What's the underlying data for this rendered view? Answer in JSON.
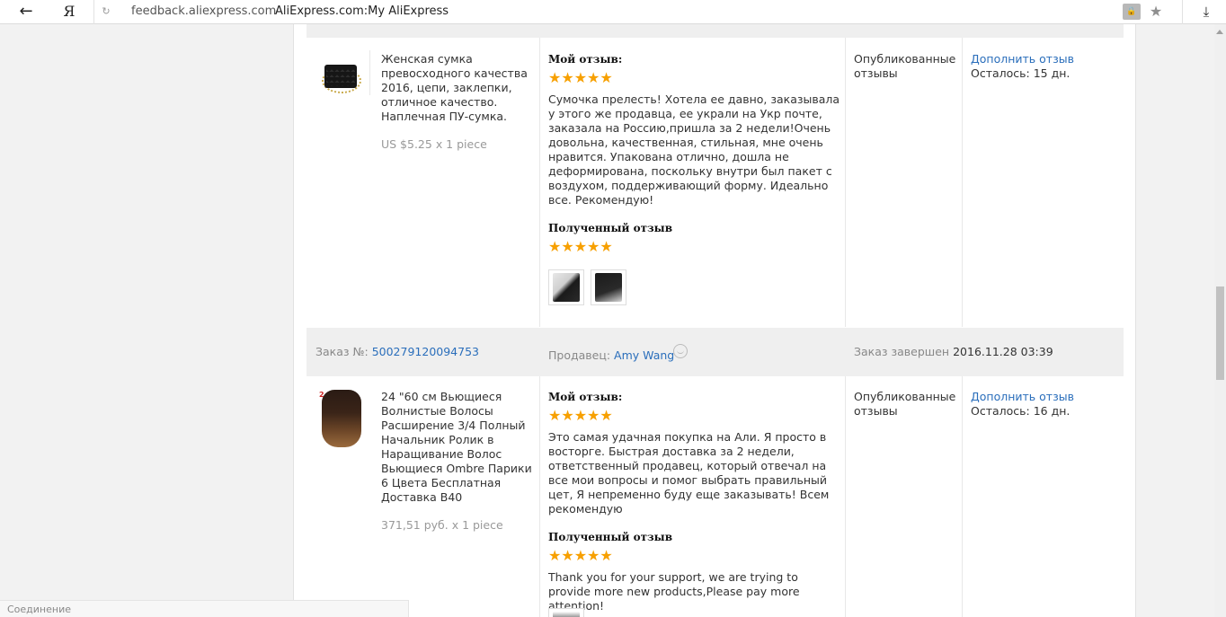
{
  "browser": {
    "url": "feedback.aliexpress.com",
    "title": "AliExpress.com:My AliExpress",
    "back_icon": "←",
    "yandex_icon": "Я",
    "reload_icon": "↻",
    "star_icon": "★",
    "download_icon": "⤓"
  },
  "rows": [
    {
      "product_title": "Женская сумка превосходного качества 2016, цепи, заклепки, отличное качество. Наплечная ПУ-сумка.",
      "price": "US $5.25 x 1 piece",
      "my_review_label": "Мой отзыв:",
      "my_stars": "★★★★★",
      "my_review": "Сумочка прелесть! Хотела ее давно, заказывала у этого же продавца, ее украли на Укр почте, заказала на Россию,пришла за 2 недели!Очень довольна, качественная, стильная, мне очень нравится. Упакована отлично, дошла не деформирована, поскольку внутри был пакет с воздухом, поддерживающий форму. Идеально все. Рекомендую!",
      "received_label": "Полученный отзыв",
      "received_stars": "★★★★★",
      "status": "Опубликованные отзывы",
      "action": "Дополнить отзыв",
      "remaining": "Осталось: 15 дн."
    },
    {
      "product_title": "24 \"60 см Вьющиеся Волнистые Волосы Расширение 3/4 Полный Начальник Ролик в Наращивание Волос Вьющиеся Ombre Парики 6 Цвета Бесплатная Доставка B40",
      "price": "371,51 руб. x 1 piece",
      "badge": "2",
      "my_review_label": "Мой отзыв:",
      "my_stars": "★★★★★",
      "my_review": "Это самая удачная покупка на Али. Я просто в восторге. Быстрая доставка за 2 недели, ответственный продавец, который отвечал на все мои вопросы и помог выбрать правильный цет, Я непременно буду еще заказывать! Всем рекомендую",
      "received_label": "Полученный отзыв",
      "received_stars": "★★★★★",
      "received_text": "Thank you for your support, we are trying to provide more new products,Please pay more attention!",
      "status": "Опубликованные отзывы",
      "action": "Дополнить отзыв",
      "remaining": "Осталось: 16 дн."
    }
  ],
  "order": {
    "number_label": "Заказ №:",
    "number": "500279120094753",
    "seller_label": "Продавец:",
    "seller": "Amy Wang",
    "done_label": "Заказ завершен",
    "done_date": "2016.11.28 03:39"
  },
  "statusbar": "Соединение"
}
